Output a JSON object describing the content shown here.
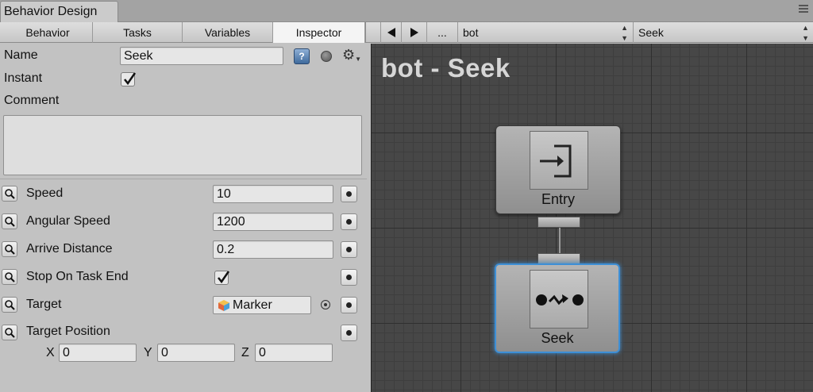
{
  "window": {
    "tab_title": "Behavior Design"
  },
  "left_tabs": [
    {
      "label": "Behavior"
    },
    {
      "label": "Tasks"
    },
    {
      "label": "Variables"
    },
    {
      "label": "Inspector",
      "active": true
    }
  ],
  "right_toolbar": {
    "back_icon": "triangle-left",
    "forward_icon": "triangle-right",
    "more_label": "...",
    "behavior_select": "bot",
    "task_select": "Seek"
  },
  "inspector": {
    "name_label": "Name",
    "name_value": "Seek",
    "instant_label": "Instant",
    "instant_checked": true,
    "comment_label": "Comment",
    "comment_value": "",
    "help_icon": "?",
    "fields": [
      {
        "label": "Speed",
        "value": "10"
      },
      {
        "label": "Angular Speed",
        "value": "1200"
      },
      {
        "label": "Arrive Distance",
        "value": "0.2"
      },
      {
        "label": "Stop On Task End",
        "checked": true
      },
      {
        "label": "Target",
        "value": "Marker"
      },
      {
        "label": "Target Position"
      }
    ],
    "position": {
      "x_label": "X",
      "x": "0",
      "y_label": "Y",
      "y": "0",
      "z_label": "Z",
      "z": "0"
    }
  },
  "graph": {
    "title": "bot - Seek",
    "nodes": [
      {
        "label": "Entry",
        "icon": "entry-arrow-icon"
      },
      {
        "label": "Seek",
        "icon": "seek-dots-icon",
        "selected": true
      }
    ]
  },
  "colors": {
    "selection": "#3d8fd6",
    "graph_bg": "#474747",
    "panel_bg": "#c2c2c2"
  }
}
